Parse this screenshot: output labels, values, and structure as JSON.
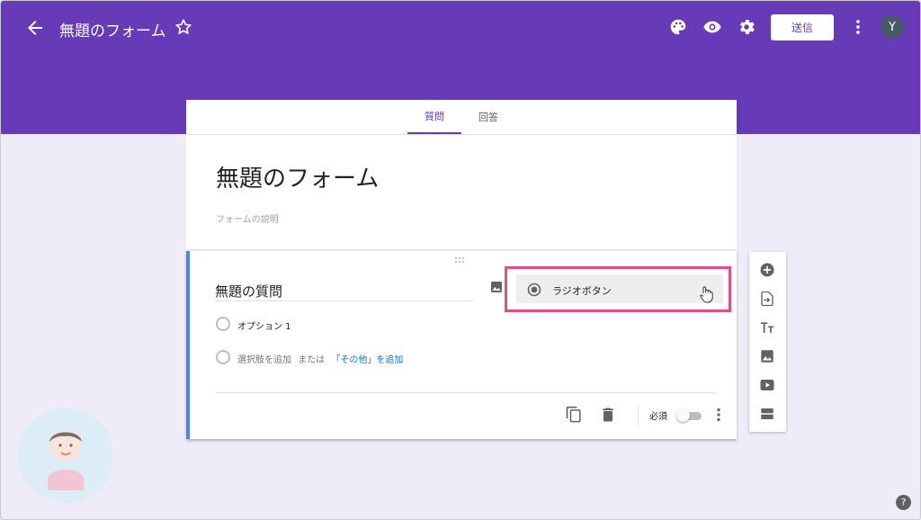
{
  "header": {
    "form_name": "無題のフォーム",
    "send_label": "送信",
    "avatar_letter": "Y",
    "icons": [
      "back-arrow-icon",
      "star-icon",
      "palette-icon",
      "eye-icon",
      "gear-icon",
      "more-vert-icon"
    ]
  },
  "tabs": [
    {
      "label": "質問",
      "active": true
    },
    {
      "label": "回答",
      "active": false
    }
  ],
  "form": {
    "title": "無題のフォーム",
    "description_placeholder": "フォームの説明"
  },
  "question": {
    "title": "無題の質問",
    "type_label": "ラジオボタン",
    "option1": "オプション 1",
    "add_option": "選択肢を追加",
    "or": "または",
    "add_other": "「その他」を追加",
    "required_label": "必須"
  },
  "colors": {
    "header_bg": "#673ab7",
    "page_bg": "#f0ebf8",
    "highlight": "#e84a86",
    "link": "#1a73e8",
    "accent_left": "#4285f4"
  },
  "sidebar_icons": [
    "add-circle-icon",
    "import-icon",
    "title-text-icon",
    "image-icon",
    "video-icon",
    "section-icon"
  ],
  "help_glyph": "?"
}
